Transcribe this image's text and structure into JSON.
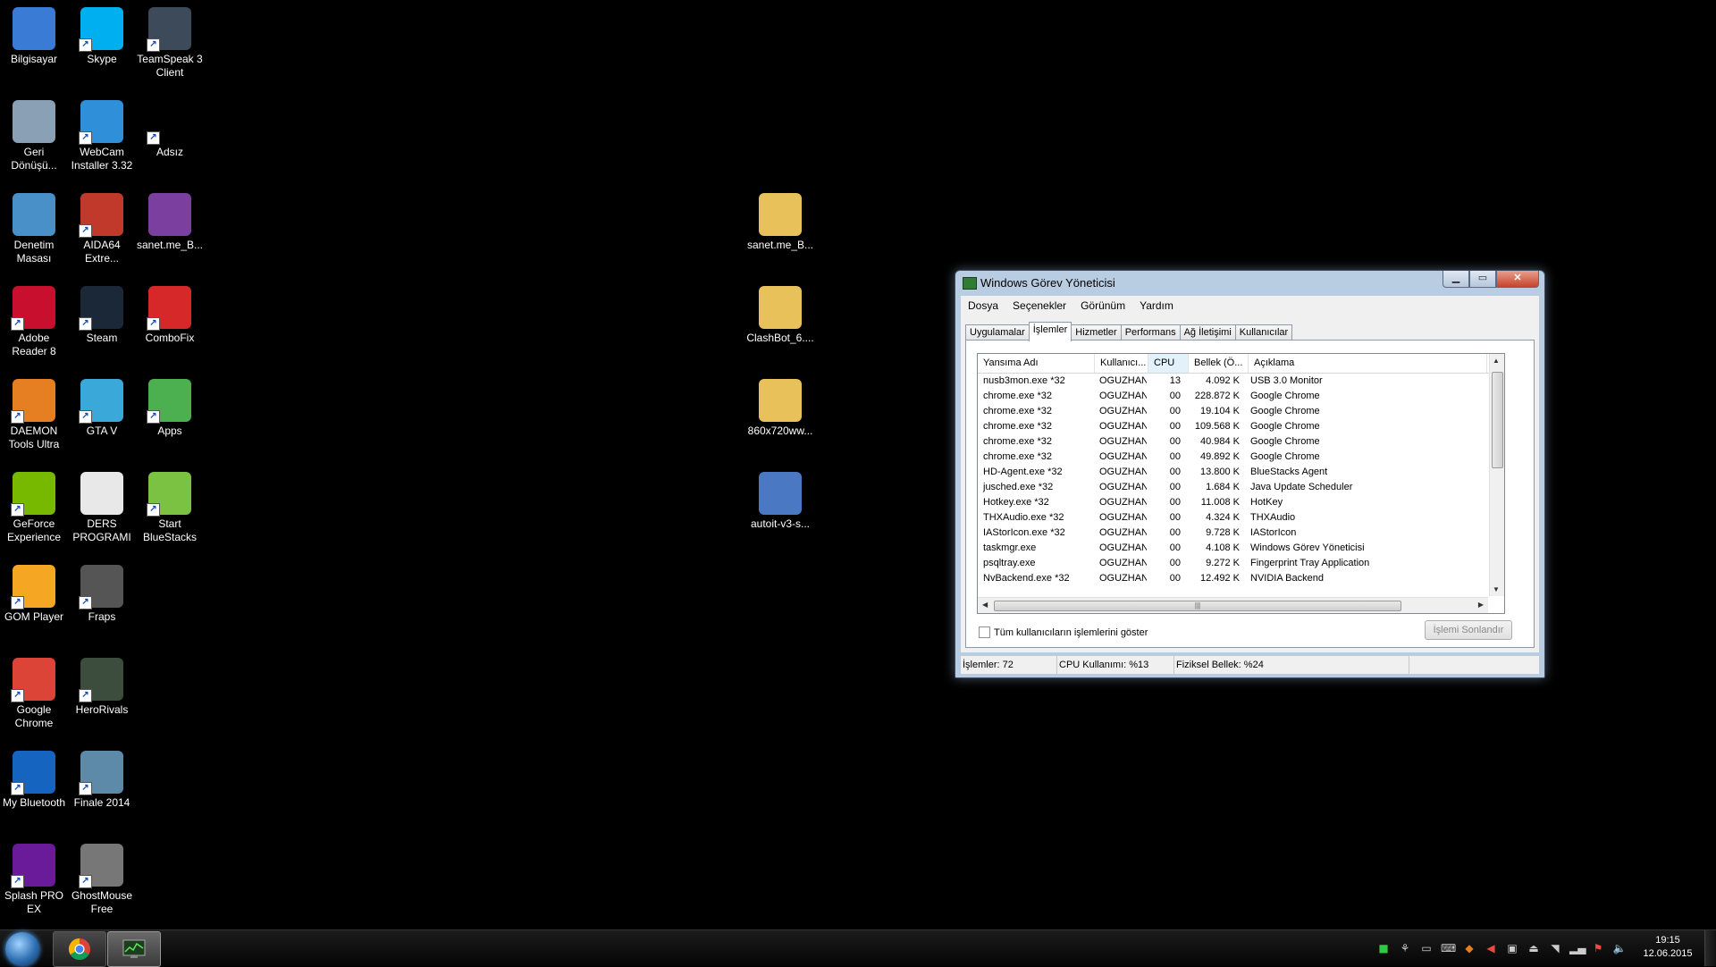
{
  "desktop": {
    "icons": [
      {
        "label": "Bilgisayar",
        "icon": "computer-icon",
        "color": "#3a7bd5"
      },
      {
        "label": "Skype",
        "icon": "skype-icon",
        "color": "#00aff0"
      },
      {
        "label": "TeamSpeak 3 Client",
        "icon": "teamspeak-icon",
        "color": "#3c4a5a"
      },
      {
        "label": "Geri Dönüşü...",
        "icon": "recycle-bin-icon",
        "color": "#8aa0b5"
      },
      {
        "label": "WebCam Installer 3.32",
        "icon": "webcam-icon",
        "color": "#2f8fd8"
      },
      {
        "label": "Adsız",
        "icon": "blank-file-icon",
        "color": "#000000"
      },
      {
        "label": "Denetim Masası",
        "icon": "control-panel-icon",
        "color": "#4a90c8"
      },
      {
        "label": "AIDA64 Extre...",
        "icon": "aida64-icon",
        "color": "#c0392b"
      },
      {
        "label": "sanet.me_B...",
        "icon": "winrar-icon",
        "color": "#7b3fa0"
      },
      {
        "label": "Adobe Reader 8",
        "icon": "adobe-reader-icon",
        "color": "#c8102e"
      },
      {
        "label": "Steam",
        "icon": "steam-icon",
        "color": "#1b2838"
      },
      {
        "label": "ComboFix",
        "icon": "combofix-icon",
        "color": "#d62828"
      },
      {
        "label": "DAEMON Tools Ultra",
        "icon": "daemon-tools-icon",
        "color": "#e67e22"
      },
      {
        "label": "GTA V",
        "icon": "gta-icon",
        "color": "#3aa8d8"
      },
      {
        "label": "Apps",
        "icon": "apps-icon",
        "color": "#4caf50"
      },
      {
        "label": "GeForce Experience",
        "icon": "geforce-icon",
        "color": "#76b900"
      },
      {
        "label": "DERS PROGRAMI",
        "icon": "document-icon",
        "color": "#e8e8e8"
      },
      {
        "label": "Start BlueStacks",
        "icon": "bluestacks-icon",
        "color": "#7cc242"
      },
      {
        "label": "GOM Player",
        "icon": "gom-player-icon",
        "color": "#f5a623"
      },
      {
        "label": "Fraps",
        "icon": "fraps-icon",
        "color": "#555555"
      },
      {
        "label": "Google Chrome",
        "icon": "chrome-icon",
        "color": "#db4437"
      },
      {
        "label": "HeroRivals",
        "icon": "herorivals-icon",
        "color": "#3d4d3d"
      },
      {
        "label": "My Bluetooth",
        "icon": "bluetooth-icon",
        "color": "#1565c0"
      },
      {
        "label": "Finale 2014",
        "icon": "finale-icon",
        "color": "#5d8aa8"
      },
      {
        "label": "Splash PRO EX",
        "icon": "splash-pro-icon",
        "color": "#6a1b9a"
      },
      {
        "label": "GhostMouse Free",
        "icon": "ghostmouse-icon",
        "color": "#777777"
      },
      {
        "label": "sanet.me_B...",
        "icon": "folder-icon",
        "color": "#e8c15a"
      },
      {
        "label": "ClashBot_6....",
        "icon": "folder-icon",
        "color": "#e8c15a"
      },
      {
        "label": "860x720ww...",
        "icon": "folder-icon",
        "color": "#e8c15a"
      },
      {
        "label": "autoit-v3-s...",
        "icon": "installer-disc-icon",
        "color": "#4a78c2"
      }
    ]
  },
  "taskmanager": {
    "title": "Windows Görev Yöneticisi",
    "menu": [
      "Dosya",
      "Seçenekler",
      "Görünüm",
      "Yardım"
    ],
    "tabs": [
      "Uygulamalar",
      "İşlemler",
      "Hizmetler",
      "Performans",
      "Ağ İletişimi",
      "Kullanıcılar"
    ],
    "active_tab": "İşlemler",
    "columns": [
      "Yansıma Adı",
      "Kullanıcı...",
      "CPU",
      "Bellek (Ö...",
      "Açıklama"
    ],
    "processes": [
      {
        "name": "nusb3mon.exe *32",
        "user": "OGUZHAN",
        "cpu": "13",
        "mem": "4.092 K",
        "desc": "USB 3.0 Monitor"
      },
      {
        "name": "chrome.exe *32",
        "user": "OGUZHAN",
        "cpu": "00",
        "mem": "228.872 K",
        "desc": "Google Chrome"
      },
      {
        "name": "chrome.exe *32",
        "user": "OGUZHAN",
        "cpu": "00",
        "mem": "19.104 K",
        "desc": "Google Chrome"
      },
      {
        "name": "chrome.exe *32",
        "user": "OGUZHAN",
        "cpu": "00",
        "mem": "109.568 K",
        "desc": "Google Chrome"
      },
      {
        "name": "chrome.exe *32",
        "user": "OGUZHAN",
        "cpu": "00",
        "mem": "40.984 K",
        "desc": "Google Chrome"
      },
      {
        "name": "chrome.exe *32",
        "user": "OGUZHAN",
        "cpu": "00",
        "mem": "49.892 K",
        "desc": "Google Chrome"
      },
      {
        "name": "HD-Agent.exe *32",
        "user": "OGUZHAN",
        "cpu": "00",
        "mem": "13.800 K",
        "desc": "BlueStacks Agent"
      },
      {
        "name": "jusched.exe *32",
        "user": "OGUZHAN",
        "cpu": "00",
        "mem": "1.684 K",
        "desc": "Java Update Scheduler"
      },
      {
        "name": "Hotkey.exe *32",
        "user": "OGUZHAN",
        "cpu": "00",
        "mem": "11.008 K",
        "desc": "HotKey"
      },
      {
        "name": "THXAudio.exe *32",
        "user": "OGUZHAN",
        "cpu": "00",
        "mem": "4.324 K",
        "desc": "THXAudio"
      },
      {
        "name": "IAStorIcon.exe *32",
        "user": "OGUZHAN",
        "cpu": "00",
        "mem": "9.728 K",
        "desc": "IAStorIcon"
      },
      {
        "name": "taskmgr.exe",
        "user": "OGUZHAN",
        "cpu": "00",
        "mem": "4.108 K",
        "desc": "Windows Görev Yöneticisi"
      },
      {
        "name": "psqltray.exe",
        "user": "OGUZHAN",
        "cpu": "00",
        "mem": "9.272 K",
        "desc": "Fingerprint Tray Application"
      },
      {
        "name": "NvBackend.exe *32",
        "user": "OGUZHAN",
        "cpu": "00",
        "mem": "12.492 K",
        "desc": "NVIDIA Backend"
      }
    ],
    "show_all_label": "Tüm kullanıcıların işlemlerini göster",
    "end_process_label": "İşlemi Sonlandır",
    "status": {
      "processes": "İşlemler: 72",
      "cpu": "CPU Kullanımı: %13",
      "memory": "Fiziksel Bellek: %24"
    }
  },
  "taskbar": {
    "clock_time": "19:15",
    "clock_date": "12.06.2015"
  }
}
